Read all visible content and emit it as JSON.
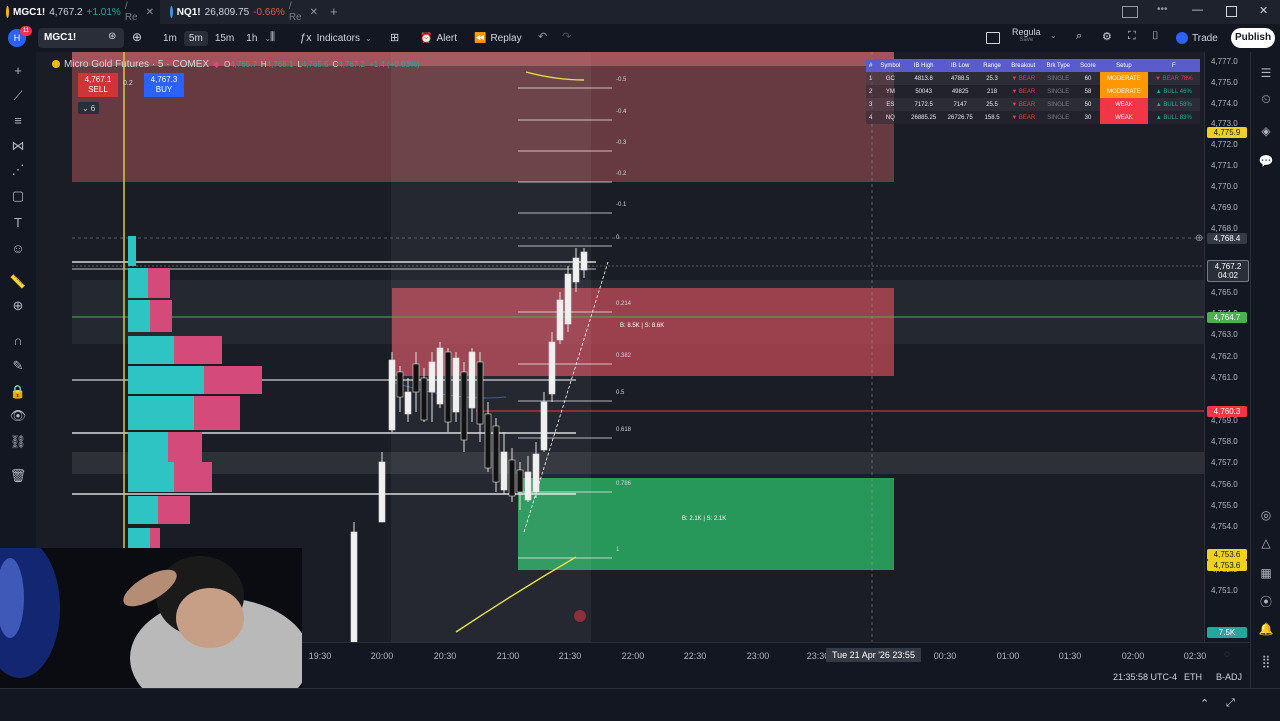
{
  "browser_tabs": [
    {
      "symbol": "MGC1!",
      "price": "4,767.2",
      "change": "+1.01%",
      "suffix": "/ Re",
      "close": "✕"
    },
    {
      "symbol": "NQ1!",
      "price": "26,809.75",
      "change": "-0.66%",
      "suffix": "/ Re",
      "close": "✕"
    }
  ],
  "new_tab": "+",
  "toolbar": {
    "avatar_badge": "11",
    "symbol": "MGC1!",
    "intervals": [
      "1m",
      "5m",
      "15m",
      "1h"
    ],
    "active_interval": "5m",
    "indicators": "Indicators",
    "alert": "Alert",
    "replay": "Replay",
    "layout_name": "Regula",
    "layout_sub": "Save",
    "trade": "Trade",
    "publish": "Publish"
  },
  "legend": {
    "title": "Micro Gold Futures · 5 · COMEX",
    "o_label": "O",
    "o": "4,765.7",
    "h_label": "H",
    "h": "4,768.1",
    "l_label": "L",
    "l": "4,765.5",
    "c_label": "C",
    "c": "4,767.2",
    "chg": "+1.4 (+0.03%)",
    "sell_price": "4,767.1",
    "sell_label": "SELL",
    "buy_price": "4,767.3",
    "buy_label": "BUY",
    "spread": "0.2",
    "indicator_count": "6"
  },
  "stats_table": {
    "headers": [
      "#",
      "Symbol",
      "IB High",
      "IB Low",
      "Range",
      "Breakout",
      "Brk Type",
      "Score",
      "Setup",
      "F"
    ],
    "rows": [
      [
        "1",
        "GC",
        "4813.8",
        "4788.5",
        "25.3",
        "▼ BEAR",
        "SINGLE",
        "60",
        "MODERATE",
        "▼ BEAR 78%"
      ],
      [
        "2",
        "YM",
        "50043",
        "49825",
        "218",
        "▼ BEAR",
        "SINGLE",
        "58",
        "MODERATE",
        "▲ BULL 46%"
      ],
      [
        "3",
        "ES",
        "7172.5",
        "7147",
        "25.5",
        "▼ BEAR",
        "SINGLE",
        "50",
        "WEAK",
        "▲ BULL 58%"
      ],
      [
        "4",
        "NQ",
        "26885.25",
        "26726.75",
        "158.5",
        "▼ BEAR",
        "SINGLE",
        "30",
        "WEAK",
        "▲ BULL 83%"
      ]
    ]
  },
  "fib_levels": [
    "-0.5",
    "-0.4",
    "-0.3",
    "-0.2",
    "-0.1",
    "0",
    "0.214",
    "0.382",
    "0.5",
    "0.618",
    "0.786",
    "1"
  ],
  "zone_labels": {
    "upper": "B: 8.5K | S: 8.6K",
    "lower": "B: 2.1K | S: 2.1K"
  },
  "y_axis_ticks": [
    "4,777.0",
    "4,775.0",
    "4,774.0",
    "4,773.0",
    "4,772.0",
    "4,771.0",
    "4,770.0",
    "4,769.0",
    "4,768.0",
    "4,766.0",
    "4,765.0",
    "4,764.0",
    "4,763.0",
    "4,762.0",
    "4,761.0",
    "4,759.0",
    "4,758.0",
    "4,757.0",
    "4,756.0",
    "4,755.0",
    "4,754.0",
    "4,752.0",
    "4,751.0"
  ],
  "y_axis_pills": {
    "yellow_top": "4,775.9",
    "crosshair": "4,768.4",
    "last": "4,767.2",
    "countdown": "04:02",
    "green": "4,764.7",
    "red": "4,760.3",
    "yellow_b1": "4,753.6",
    "yellow_b2": "4,753.6",
    "volume": "7.5K"
  },
  "x_axis_ticks": [
    "19:30",
    "20:00",
    "20:30",
    "21:00",
    "21:30",
    "22:00",
    "22:30",
    "23:00",
    "23:30",
    "00:30",
    "01:00",
    "01:30",
    "02:00",
    "02:30"
  ],
  "x_crosshair_label": "Tue 21 Apr '26   23:55",
  "status": {
    "time": "21:35:58 UTC-4",
    "session": "ETH",
    "adj": "B-ADJ"
  },
  "colors": {
    "bg": "#131722",
    "chart_bg": "#1a1d25",
    "red_zone": "#e8515b",
    "green_zone": "#2ecc71",
    "cyan_profile": "#2ec4c4",
    "pink_profile": "#d44a7a",
    "accent_blue": "#2962ff"
  }
}
